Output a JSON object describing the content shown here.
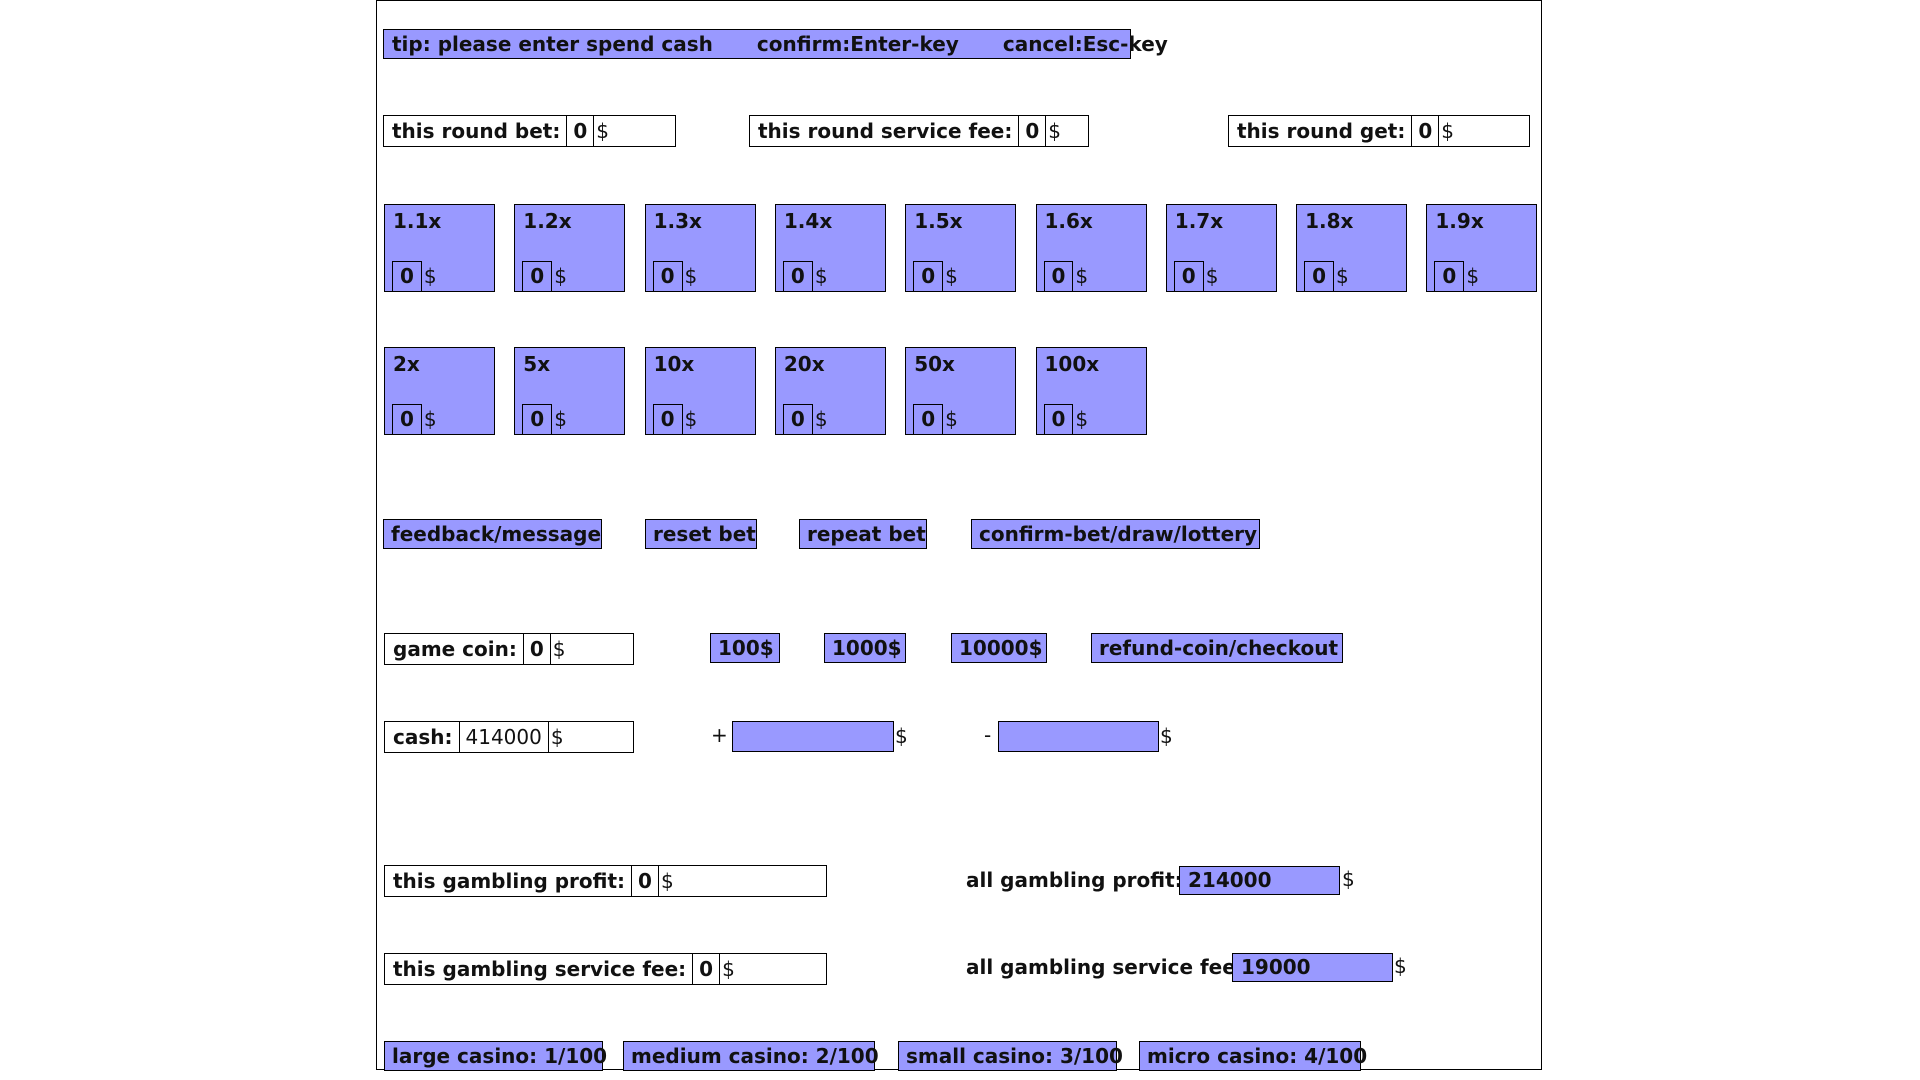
{
  "colors": {
    "accent_blue": "#9999ff",
    "active_green": "#99ff99",
    "border": "#000000"
  },
  "tip_bar": {
    "tip": "tip: please enter spend cash",
    "confirm": "confirm:Enter-key",
    "cancel": "cancel:Esc-key"
  },
  "round": {
    "bet": {
      "label": "this round bet:",
      "value": "0",
      "currency": "$"
    },
    "service_fee": {
      "label": "this round service fee:",
      "value": "0",
      "currency": "$"
    },
    "get": {
      "label": "this round get:",
      "value": "0",
      "currency": "$"
    }
  },
  "multipliers": [
    {
      "label": "1.1x",
      "bet": "0",
      "currency": "$"
    },
    {
      "label": "1.2x",
      "bet": "0",
      "currency": "$"
    },
    {
      "label": "1.3x",
      "bet": "0",
      "currency": "$"
    },
    {
      "label": "1.4x",
      "bet": "0",
      "currency": "$"
    },
    {
      "label": "1.5x",
      "bet": "0",
      "currency": "$"
    },
    {
      "label": "1.6x",
      "bet": "0",
      "currency": "$"
    },
    {
      "label": "1.7x",
      "bet": "0",
      "currency": "$"
    },
    {
      "label": "1.8x",
      "bet": "0",
      "currency": "$"
    },
    {
      "label": "1.9x",
      "bet": "0",
      "currency": "$"
    },
    {
      "label": "2x",
      "bet": "0",
      "currency": "$"
    },
    {
      "label": "5x",
      "bet": "0",
      "currency": "$"
    },
    {
      "label": "10x",
      "bet": "0",
      "currency": "$"
    },
    {
      "label": "20x",
      "bet": "0",
      "currency": "$"
    },
    {
      "label": "50x",
      "bet": "0",
      "currency": "$"
    },
    {
      "label": "100x",
      "bet": "0",
      "currency": "$"
    }
  ],
  "actions": {
    "feedback": "feedback/message",
    "reset_bet": "reset bet",
    "repeat_bet": "repeat bet",
    "confirm_bet": "confirm-bet/draw/lottery"
  },
  "coins": {
    "game_coin": {
      "label": "game coin:",
      "value": "0",
      "currency": "$"
    },
    "buy_buttons": [
      "100$",
      "1000$",
      "10000$"
    ],
    "refund": "refund-coin/checkout"
  },
  "cash": {
    "label": "cash:",
    "value": "414000",
    "currency": "$",
    "add_sign": "+",
    "add_value": "",
    "add_currency": "$",
    "sub_sign": "-",
    "sub_value": "",
    "sub_currency": "$"
  },
  "gambling": {
    "this_profit": {
      "label": "this gambling profit:",
      "value": "0",
      "currency": "$"
    },
    "this_fee": {
      "label": "this gambling service fee:",
      "value": "0",
      "currency": "$"
    },
    "all_profit": {
      "label": "all gambling profit:",
      "value": "214000",
      "currency": "$"
    },
    "all_fee": {
      "label": "all gambling service fee:",
      "value": "19000",
      "currency": "$"
    }
  },
  "casinos": [
    {
      "label": "large casino: 1/100",
      "active": true
    },
    {
      "label": "medium casino: 2/100",
      "active": false
    },
    {
      "label": "small casino: 3/100",
      "active": false
    },
    {
      "label": "micro casino: 4/100",
      "active": false
    }
  ]
}
